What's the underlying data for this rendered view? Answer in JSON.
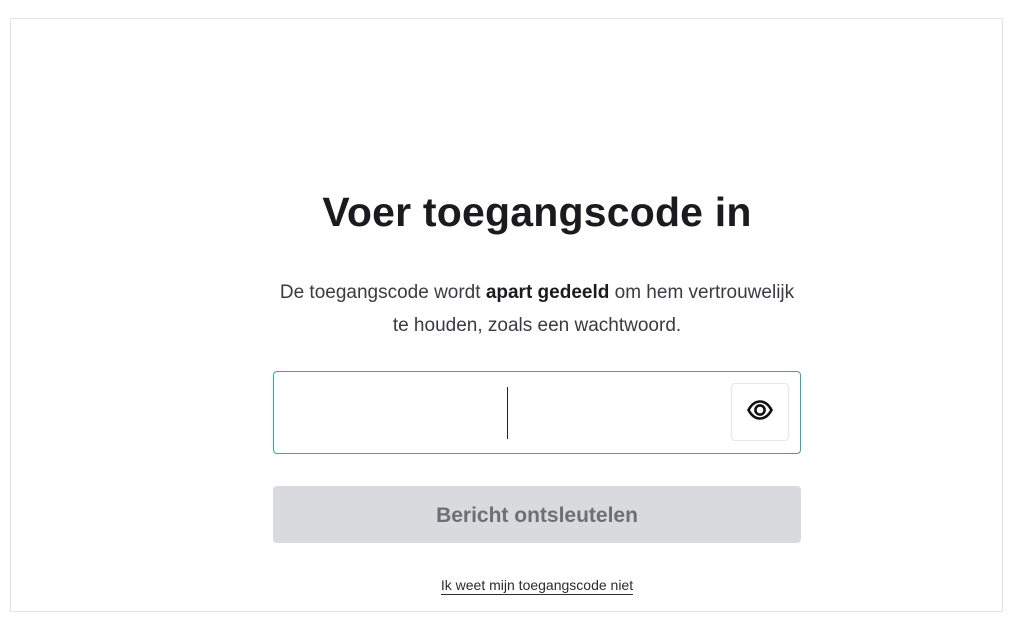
{
  "page": {
    "title": "Voer toegangscode in",
    "description_parts": {
      "before": "De toegangscode wordt ",
      "bold": "apart gedeeld",
      "after": " om hem vertrouwelijk te houden, zoals een wachtwoord."
    }
  },
  "code_field": {
    "value": "",
    "placeholder": "",
    "toggle_icon": "eye-icon"
  },
  "actions": {
    "decrypt_label": "Bericht ontsleutelen",
    "forgot_label": "Ik weet mijn toegangscode niet"
  },
  "colors": {
    "focus_border": "#33a5ad",
    "disabled_button_bg": "#d8dadd",
    "disabled_button_text": "#6c6f75"
  }
}
